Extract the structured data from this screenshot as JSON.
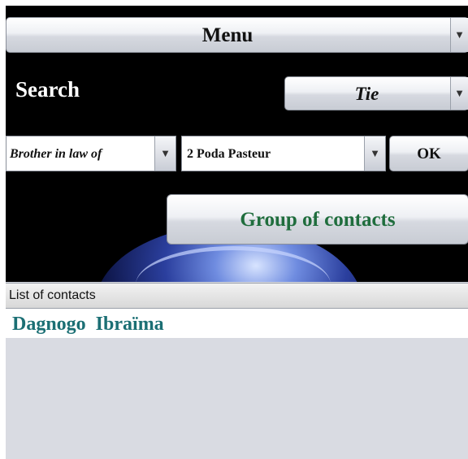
{
  "menu": {
    "label": "Menu"
  },
  "search": {
    "label": "Search",
    "type_select": "Tie"
  },
  "filter": {
    "relation_select": "Brother in law of",
    "person_select": "2 Poda  Pasteur",
    "ok_label": "OK"
  },
  "group_button": {
    "label": "Group of contacts"
  },
  "contacts": {
    "header": "List of contacts",
    "items": [
      {
        "label": "Dagnogo  Ibraïma"
      }
    ]
  },
  "icons": {
    "dropdown": "▼"
  },
  "colors": {
    "background": "#000000",
    "group_text": "#1f6d3d",
    "contact_text": "#1b6f74",
    "list_bg": "#d9dbe2"
  }
}
